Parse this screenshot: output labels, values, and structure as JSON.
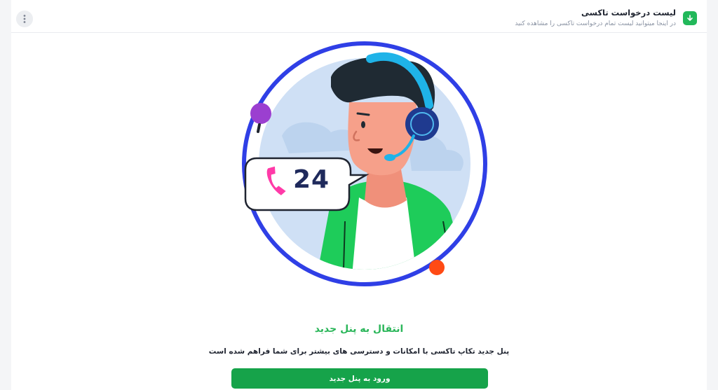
{
  "header": {
    "title": "لیست درخواست تاکسی",
    "subtitle": "در اینجا میتوانید لیست تمام درخواست تاکسی را مشاهده کنید",
    "badge_icon": "download-icon",
    "menu_icon": "kebab-menu-icon"
  },
  "illustration": {
    "badge_number": "24",
    "subject": "support-agent-with-headset"
  },
  "main": {
    "title": "انتقال به پنل جدید",
    "description": "پنل جدید تکاپ تاکسی با امکانات و دسترسی های بیشتر برای شما فراهم شده است",
    "button_label": "ورود به پنل جدید"
  },
  "colors": {
    "accent_green": "#16a34a",
    "title_green": "#2bb65a",
    "ring_blue": "#2f3fe6",
    "dot_purple": "#9b3fd0",
    "dot_orange": "#ff4a14"
  }
}
